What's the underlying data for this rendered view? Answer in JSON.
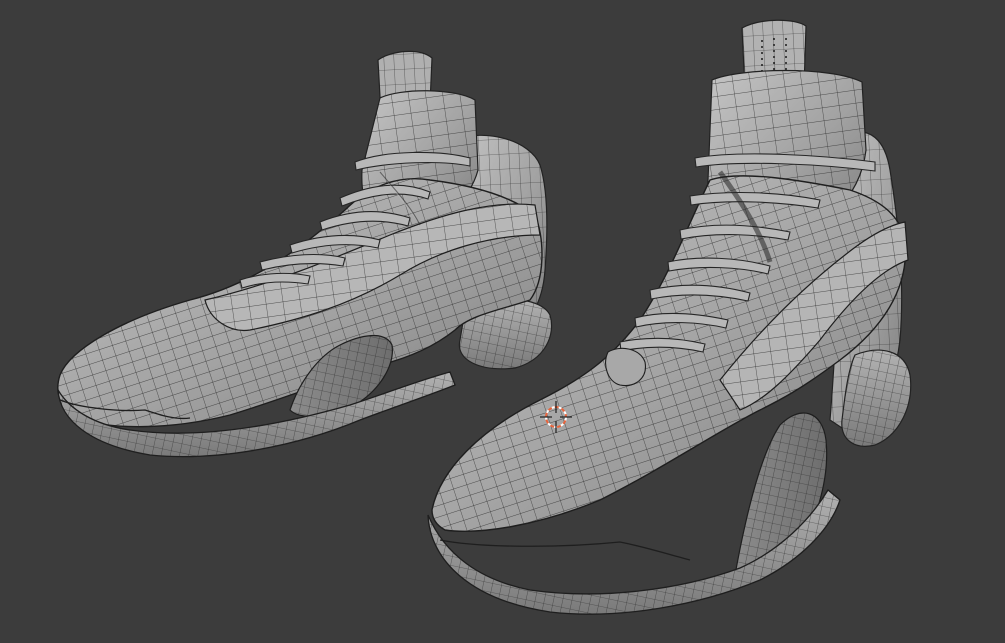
{
  "viewport": {
    "mode": "3D Viewport",
    "shading": "solid",
    "overlay": "wireframe",
    "background_color": "#3c3c3c",
    "mesh_color": "#a9a9a9",
    "wire_color": "#2a2a2a"
  },
  "scene": {
    "objects": [
      {
        "name": "left-sneaker",
        "type": "mesh"
      },
      {
        "name": "right-sneaker",
        "type": "mesh"
      }
    ],
    "cursor_icon": "3d-cursor-icon"
  },
  "colors": {
    "cursor_ring": "#e8643c",
    "cursor_cross": "#ffffff"
  }
}
